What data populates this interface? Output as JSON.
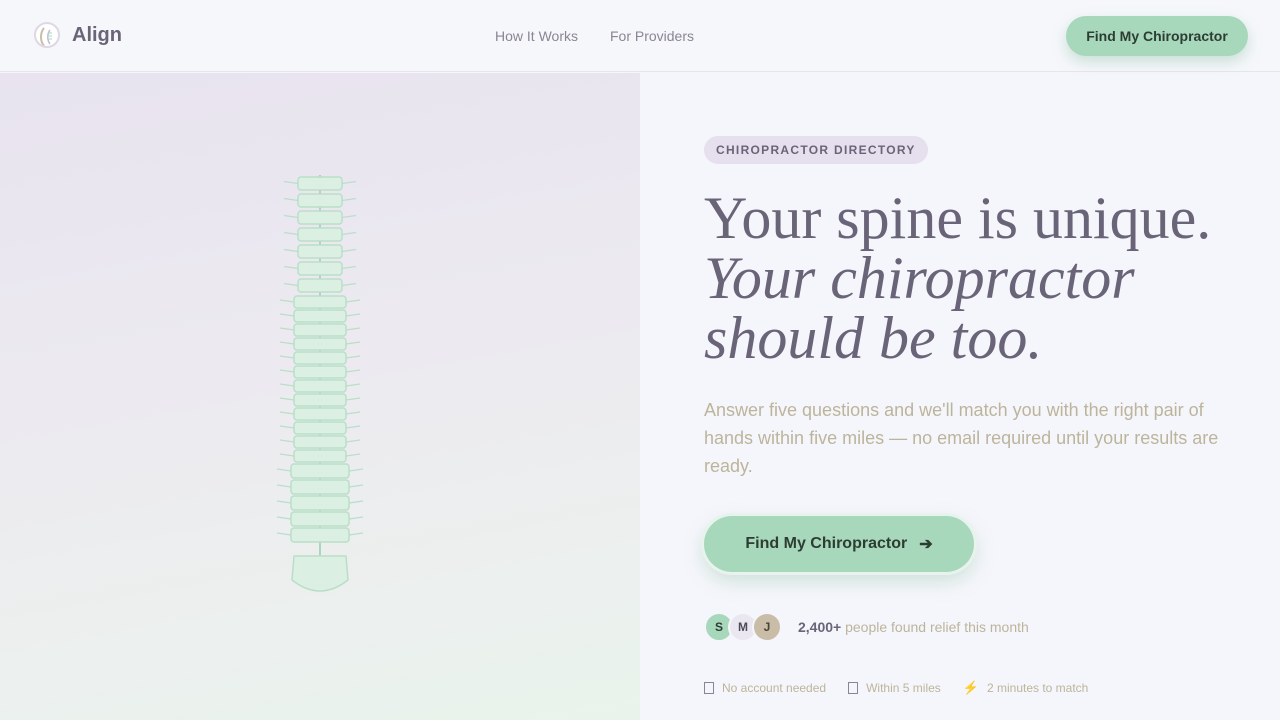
{
  "nav": {
    "brand": "Align",
    "links": [
      "How It Works",
      "For Providers"
    ],
    "cta": "Find My Chiropractor"
  },
  "hero": {
    "eyebrow": "CHIROPRACTOR DIRECTORY",
    "headline_line1": "Your spine is unique.",
    "headline_line2": "Your chiropractor",
    "headline_line3": "should be too.",
    "subtitle": "Answer five questions and we'll match you with the right pair of hands within five miles — no email required until your results are ready.",
    "cta": "Find My Chiropractor",
    "cta_icon": "arrow-right-icon",
    "avatars": [
      "S",
      "M",
      "J"
    ],
    "proof_count": "2,400+",
    "proof_text": "people found relief this month",
    "badges": [
      {
        "icon": "account-icon",
        "label": "No account needed"
      },
      {
        "icon": "location-icon",
        "label": "Within 5 miles"
      },
      {
        "icon": "bolt-icon",
        "label": "2 minutes to match"
      }
    ]
  },
  "colors": {
    "accent": "#a7d8bb",
    "text": "#6a6478",
    "muted": "#bdb49c",
    "eyebrow_bg": "#e6dfee"
  }
}
